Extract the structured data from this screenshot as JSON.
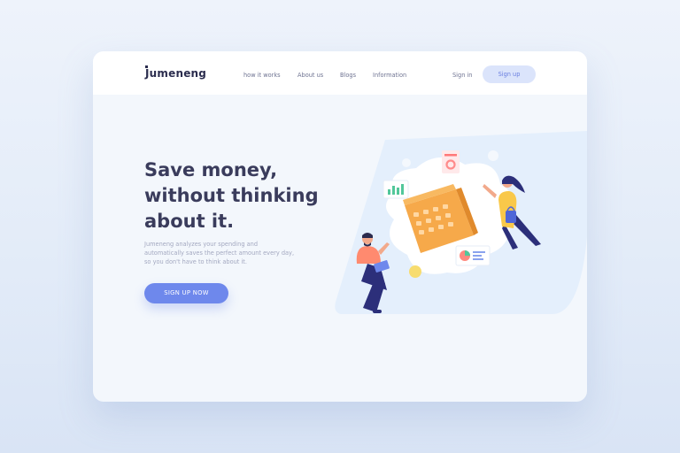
{
  "brand": {
    "name": "Jumeneng"
  },
  "nav": {
    "links": [
      {
        "label": "how it works"
      },
      {
        "label": "About us"
      },
      {
        "label": "Blogs"
      },
      {
        "label": "Information"
      }
    ],
    "signin_label": "Sign in",
    "signup_label": "Sign up"
  },
  "hero": {
    "title_lines": [
      "Save money,",
      "without thinking",
      "about it."
    ],
    "description_lines": [
      "Jumeneng analyzes your spending and",
      "automatically saves the perfect amount every day,",
      "so you don't have to think about it."
    ],
    "cta_label": "SIGN UP NOW"
  },
  "colors": {
    "page_bg": "#e6eef9",
    "card_bg": "#f3f7fc",
    "accent": "#6e88ec",
    "signup_bg": "#dbe4fb",
    "title": "#3a3c5c",
    "calendar": "#f6a94a"
  },
  "icons": {
    "calendar": "calendar-icon",
    "bar_chart": "bar-chart-icon",
    "pie_chart": "pie-chart-icon",
    "donut_chart": "donut-chart-icon",
    "coin": "coin-icon"
  }
}
